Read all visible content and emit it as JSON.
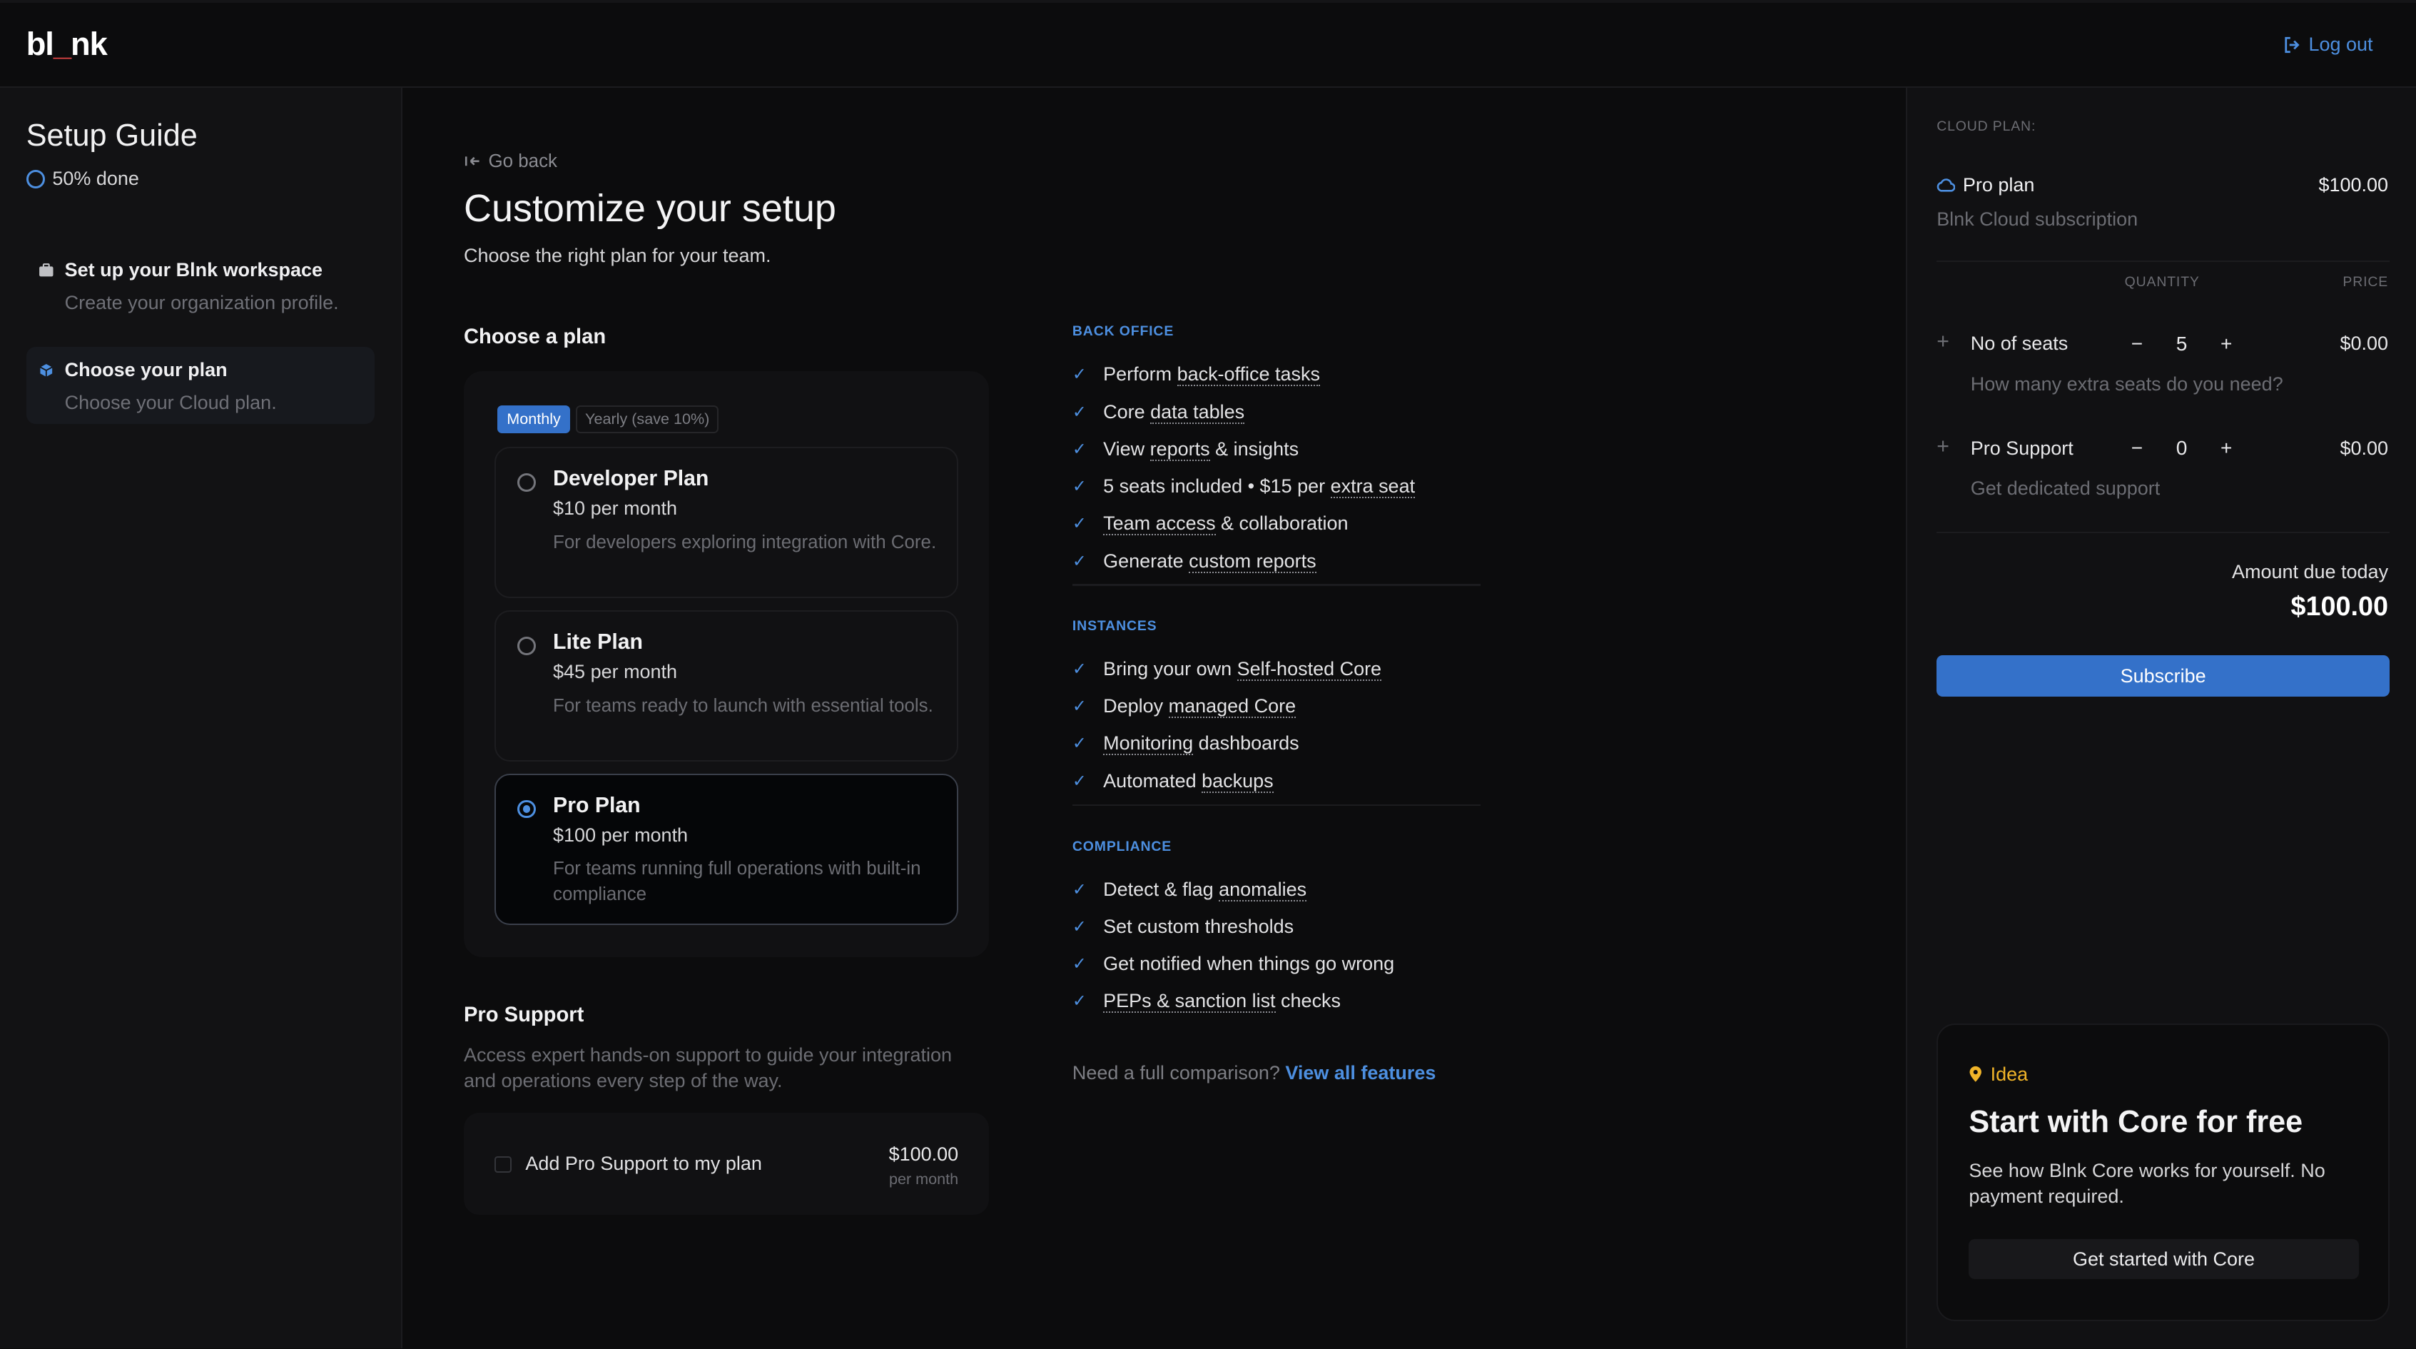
{
  "header": {
    "logo_pre": "bl",
    "logo_dot": "_",
    "logo_post": "nk",
    "logout_label": "Log out",
    "logout_icon": "logout-icon"
  },
  "sidebar": {
    "title": "Setup Guide",
    "progress": "50% done",
    "steps": [
      {
        "title": "Set up your Blnk workspace",
        "subtitle": "Create your organization profile.",
        "icon": "briefcase-icon"
      },
      {
        "title": "Choose your plan",
        "subtitle": "Choose your Cloud plan.",
        "icon": "cube-icon"
      }
    ]
  },
  "main": {
    "back_label": "Go back",
    "title": "Customize your setup",
    "subtitle": "Choose the right plan for your team.",
    "choose_plan_title": "Choose a plan",
    "billing": {
      "monthly": "Monthly",
      "yearly": "Yearly (save 10%)"
    },
    "plans": [
      {
        "name": "Developer Plan",
        "price": "$10 per month",
        "desc": "For developers exploring integration with Core."
      },
      {
        "name": "Lite Plan",
        "price": "$45 per month",
        "desc": "For teams ready to launch with essential tools."
      },
      {
        "name": "Pro Plan",
        "price": "$100 per month",
        "desc": "For teams running full operations with built-in compliance"
      }
    ],
    "pro_support": {
      "title": "Pro Support",
      "desc": "Access expert hands-on support to guide your integration and operations every step of the way.",
      "checkbox_label": "Add Pro Support to my plan",
      "price": "$100.00",
      "per": "per month"
    }
  },
  "features": {
    "back_office": {
      "heading": "BACK OFFICE",
      "items": [
        [
          "Perform ",
          "back-office tasks",
          ""
        ],
        [
          "Core ",
          "data tables",
          ""
        ],
        [
          "View ",
          "reports",
          " & insights"
        ],
        [
          "5 seats included • $15 per ",
          "extra seat",
          ""
        ],
        [
          "",
          "Team access",
          " & collaboration"
        ],
        [
          "Generate ",
          "custom reports",
          ""
        ]
      ]
    },
    "instances": {
      "heading": "INSTANCES",
      "items": [
        [
          "Bring your own ",
          "Self-hosted Core",
          ""
        ],
        [
          "Deploy ",
          "managed Core",
          ""
        ],
        [
          "",
          "Monitoring",
          " dashboards"
        ],
        [
          "Automated ",
          "backups",
          ""
        ]
      ]
    },
    "compliance": {
      "heading": "COMPLIANCE",
      "items": [
        [
          "Detect & flag ",
          "anomalies",
          ""
        ],
        [
          "Set custom thresholds",
          "",
          ""
        ],
        [
          "Get notified when things go wrong",
          "",
          ""
        ],
        [
          "",
          "PEPs & sanction list",
          " checks"
        ]
      ]
    },
    "compare_text": "Need a full comparison?",
    "compare_link": "View all features"
  },
  "summary": {
    "label": "CLOUD PLAN:",
    "plan_name": "Pro plan",
    "plan_price": "$100.00",
    "plan_sub": "Blnk Cloud subscription",
    "col_quantity": "QUANTITY",
    "col_price": "PRICE",
    "lines": [
      {
        "name": "No of seats",
        "qty": "5",
        "price": "$0.00",
        "sub": "How many extra seats do you need?"
      },
      {
        "name": "Pro Support",
        "qty": "0",
        "price": "$0.00",
        "sub": "Get dedicated support"
      }
    ],
    "minus": "−",
    "plus": "+",
    "due_label": "Amount due today",
    "due_amount": "$100.00",
    "subscribe_label": "Subscribe"
  },
  "idea": {
    "tag": "Idea",
    "title": "Start with Core for free",
    "desc": "See how Blnk Core works for yourself. No payment required.",
    "button": "Get started with Core"
  },
  "colors": {
    "accent": "#3471c9",
    "link": "#4d8fe0",
    "idea": "#f0b429"
  }
}
